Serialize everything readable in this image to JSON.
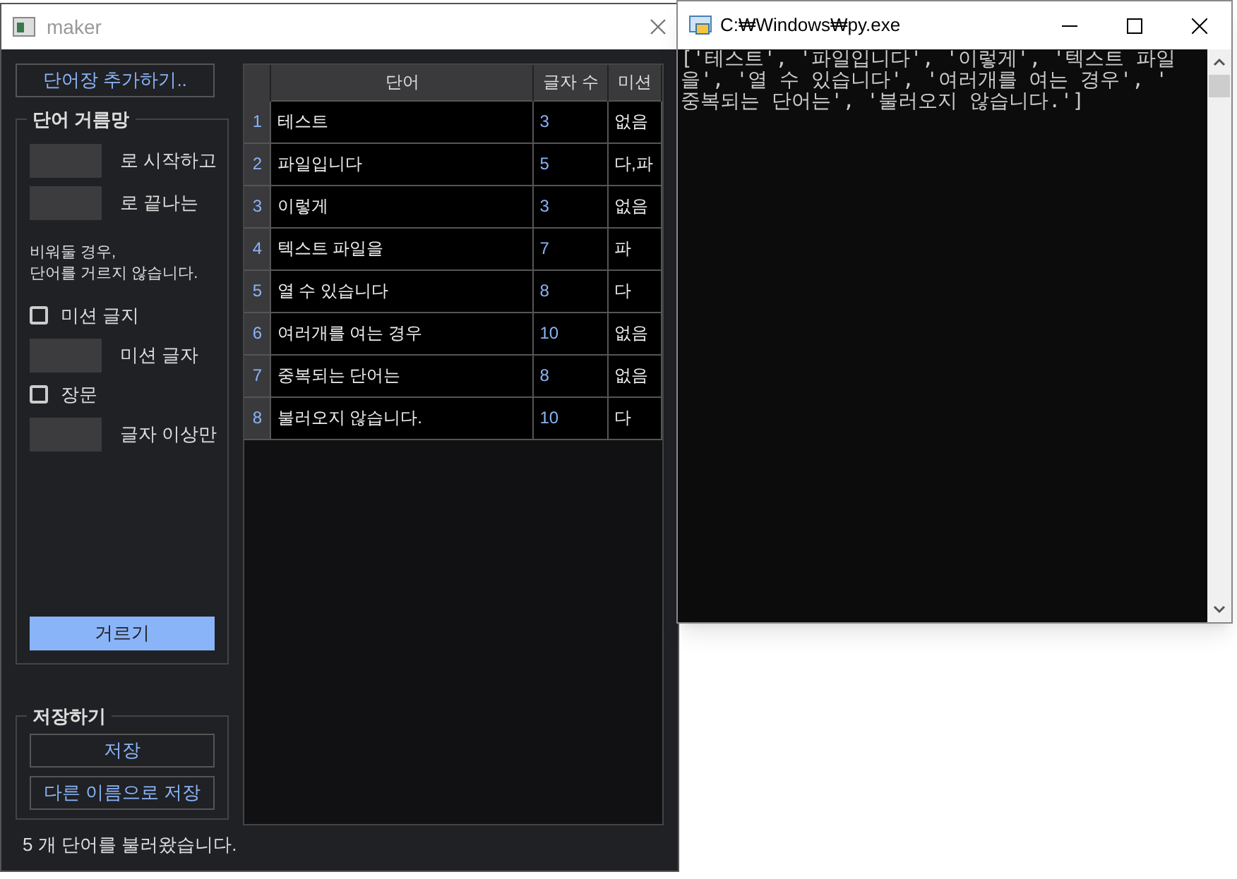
{
  "maker_window": {
    "title": "maker",
    "add_wordbook_button": "단어장 추가하기..",
    "filter_group": {
      "title": "단어 거름망",
      "fields": [
        {
          "kind": "input",
          "label": "로 시작하고"
        },
        {
          "kind": "input",
          "label": "로 끝나는"
        },
        {
          "kind": "note",
          "label": "비워둘 경우,\n단어를 거르지 않습니다."
        },
        {
          "kind": "checkbox",
          "label": "미션 글지",
          "checked": false
        },
        {
          "kind": "input",
          "label": "미션 글자"
        },
        {
          "kind": "checkbox",
          "label": "장문",
          "checked": false
        },
        {
          "kind": "input",
          "label": "글자 이상만"
        }
      ],
      "filter_button": "거르기"
    },
    "save_group": {
      "title": "저장하기",
      "buttons": [
        "저장",
        "다른 이름으로 저장"
      ]
    },
    "table": {
      "columns": [
        "",
        "단어",
        "글자 수",
        "미션"
      ],
      "rows": [
        [
          "1",
          "테스트",
          "3",
          "없음"
        ],
        [
          "2",
          "파일입니다",
          "5",
          "다,파"
        ],
        [
          "3",
          "이렇게",
          "3",
          "없음"
        ],
        [
          "4",
          "텍스트 파일을",
          "7",
          "파"
        ],
        [
          "5",
          "열 수 있습니다",
          "8",
          "다"
        ],
        [
          "6",
          "여러개를 여는 경우",
          "10",
          "없음"
        ],
        [
          "7",
          "중복되는 단어는",
          "8",
          "없음"
        ],
        [
          "8",
          "불러오지 않습니다.",
          "10",
          "다"
        ]
      ]
    },
    "status_bar": "5 개 단어를 불러왔습니다."
  },
  "console_window": {
    "title": "C:₩Windows₩py.exe",
    "output_lines": [
      "['테스트', '파일입니다', '이렇게', '텍스트 파일",
      "을', '열 수 있습니다', '여러개를 여는 경우', '",
      "중복되는 단어는', '불러오지 않습니다.']"
    ]
  }
}
